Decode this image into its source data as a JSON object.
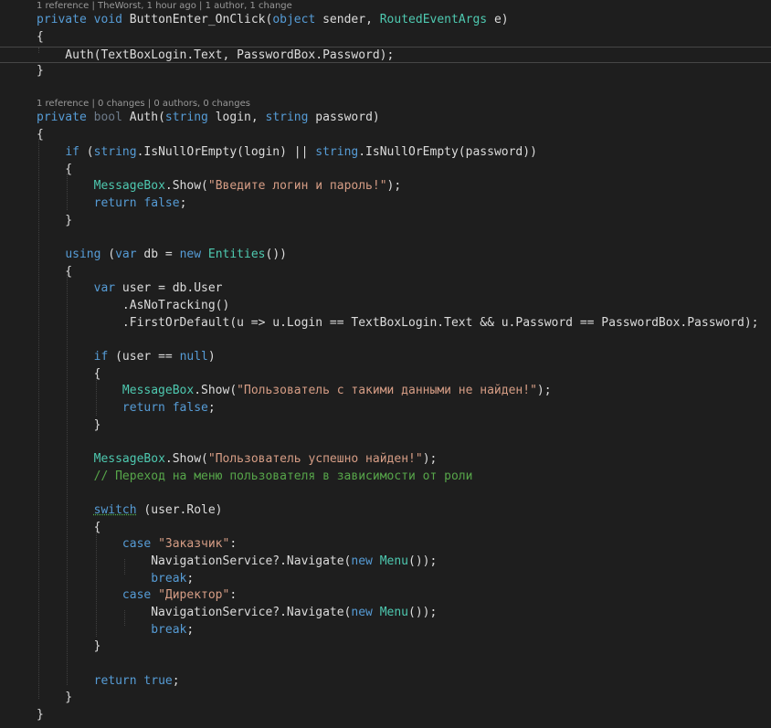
{
  "editor": {
    "lens": [
      [
        {
          "t": "1 reference"
        },
        {
          "t": " | ",
          "c": "sep"
        },
        {
          "t": "TheWorst, 1 hour ago"
        },
        {
          "t": " | ",
          "c": "sep"
        },
        {
          "t": "1 author, 1 change"
        }
      ],
      [
        {
          "t": "1 reference"
        },
        {
          "t": " | ",
          "c": "sep"
        },
        {
          "t": "0 changes"
        },
        {
          "t": " | ",
          "c": "sep"
        },
        {
          "t": "0 authors, 0 changes"
        }
      ]
    ],
    "lines": [
      [
        {
          "t": "private",
          "c": "kw"
        },
        {
          "t": " "
        },
        {
          "t": "void",
          "c": "kw"
        },
        {
          "t": " ButtonEnter_OnClick("
        },
        {
          "t": "object",
          "c": "kw"
        },
        {
          "t": " sender, "
        },
        {
          "t": "RoutedEventArgs",
          "c": "type"
        },
        {
          "t": " e)"
        }
      ],
      [
        {
          "t": "{"
        }
      ],
      [
        {
          "t": "    Auth(TextBoxLogin.Text, PasswordBox.Password);"
        }
      ],
      [
        {
          "t": "}"
        }
      ],
      [
        {
          "t": "private",
          "c": "kw"
        },
        {
          "t": " "
        },
        {
          "t": "bool",
          "c": "fade"
        },
        {
          "t": " Auth("
        },
        {
          "t": "string",
          "c": "kw"
        },
        {
          "t": " login, "
        },
        {
          "t": "string",
          "c": "kw"
        },
        {
          "t": " password)"
        }
      ],
      [
        {
          "t": "{"
        }
      ],
      [
        {
          "t": "    "
        },
        {
          "t": "if",
          "c": "kw"
        },
        {
          "t": " ("
        },
        {
          "t": "string",
          "c": "kw"
        },
        {
          "t": ".IsNullOrEmpty(login) || "
        },
        {
          "t": "string",
          "c": "kw"
        },
        {
          "t": ".IsNullOrEmpty(password))"
        }
      ],
      [
        {
          "t": "    {"
        }
      ],
      [
        {
          "t": "        "
        },
        {
          "t": "MessageBox",
          "c": "type"
        },
        {
          "t": ".Show("
        },
        {
          "t": "\"Введите логин и пароль!\"",
          "c": "str"
        },
        {
          "t": ");"
        }
      ],
      [
        {
          "t": "        "
        },
        {
          "t": "return",
          "c": "kw"
        },
        {
          "t": " "
        },
        {
          "t": "false",
          "c": "kw"
        },
        {
          "t": ";"
        }
      ],
      [
        {
          "t": "    }"
        }
      ],
      [
        {
          "t": ""
        }
      ],
      [
        {
          "t": "    "
        },
        {
          "t": "using",
          "c": "kw"
        },
        {
          "t": " ("
        },
        {
          "t": "var",
          "c": "kw"
        },
        {
          "t": " db = "
        },
        {
          "t": "new",
          "c": "kw"
        },
        {
          "t": " "
        },
        {
          "t": "Entities",
          "c": "type"
        },
        {
          "t": "())"
        }
      ],
      [
        {
          "t": "    {"
        }
      ],
      [
        {
          "t": "        "
        },
        {
          "t": "var",
          "c": "kw"
        },
        {
          "t": " user = db.User"
        }
      ],
      [
        {
          "t": "            .AsNoTracking()"
        }
      ],
      [
        {
          "t": "            .FirstOrDefault(u => u.Login == TextBoxLogin.Text && u.Password == PasswordBox.Password);"
        }
      ],
      [
        {
          "t": ""
        }
      ],
      [
        {
          "t": "        "
        },
        {
          "t": "if",
          "c": "kw"
        },
        {
          "t": " (user == "
        },
        {
          "t": "null",
          "c": "kw"
        },
        {
          "t": ")"
        }
      ],
      [
        {
          "t": "        {"
        }
      ],
      [
        {
          "t": "            "
        },
        {
          "t": "MessageBox",
          "c": "type"
        },
        {
          "t": ".Show("
        },
        {
          "t": "\"Пользователь с такими данными не найден!\"",
          "c": "str"
        },
        {
          "t": ");"
        }
      ],
      [
        {
          "t": "            "
        },
        {
          "t": "return",
          "c": "kw"
        },
        {
          "t": " "
        },
        {
          "t": "false",
          "c": "kw"
        },
        {
          "t": ";"
        }
      ],
      [
        {
          "t": "        }"
        }
      ],
      [
        {
          "t": ""
        }
      ],
      [
        {
          "t": "        "
        },
        {
          "t": "MessageBox",
          "c": "type"
        },
        {
          "t": ".Show("
        },
        {
          "t": "\"Пользователь успешно найден!\"",
          "c": "str"
        },
        {
          "t": ");"
        }
      ],
      [
        {
          "t": "        "
        },
        {
          "t": "// Переход на меню пользователя в зависимости от роли",
          "c": "cmt"
        }
      ],
      [
        {
          "t": ""
        }
      ],
      [
        {
          "t": "        "
        },
        {
          "t": "switch",
          "c": "kw swline"
        },
        {
          "t": " (user.Role)"
        }
      ],
      [
        {
          "t": "        {"
        }
      ],
      [
        {
          "t": "            "
        },
        {
          "t": "case",
          "c": "kw"
        },
        {
          "t": " "
        },
        {
          "t": "\"Заказчик\"",
          "c": "str"
        },
        {
          "t": ":"
        }
      ],
      [
        {
          "t": "                NavigationService?.Navigate("
        },
        {
          "t": "new",
          "c": "kw"
        },
        {
          "t": " "
        },
        {
          "t": "Menu",
          "c": "type"
        },
        {
          "t": "());"
        }
      ],
      [
        {
          "t": "                "
        },
        {
          "t": "break",
          "c": "kw"
        },
        {
          "t": ";"
        }
      ],
      [
        {
          "t": "            "
        },
        {
          "t": "case",
          "c": "kw"
        },
        {
          "t": " "
        },
        {
          "t": "\"Директор\"",
          "c": "str"
        },
        {
          "t": ":"
        }
      ],
      [
        {
          "t": "                NavigationService?.Navigate("
        },
        {
          "t": "new",
          "c": "kw"
        },
        {
          "t": " "
        },
        {
          "t": "Menu",
          "c": "type"
        },
        {
          "t": "());"
        }
      ],
      [
        {
          "t": "                "
        },
        {
          "t": "break",
          "c": "kw"
        },
        {
          "t": ";"
        }
      ],
      [
        {
          "t": "        }"
        }
      ],
      [
        {
          "t": ""
        }
      ],
      [
        {
          "t": "        "
        },
        {
          "t": "return",
          "c": "kw"
        },
        {
          "t": " "
        },
        {
          "t": "true",
          "c": "kw"
        },
        {
          "t": ";"
        }
      ],
      [
        {
          "t": "    }"
        }
      ],
      [
        {
          "t": "}"
        }
      ]
    ]
  }
}
